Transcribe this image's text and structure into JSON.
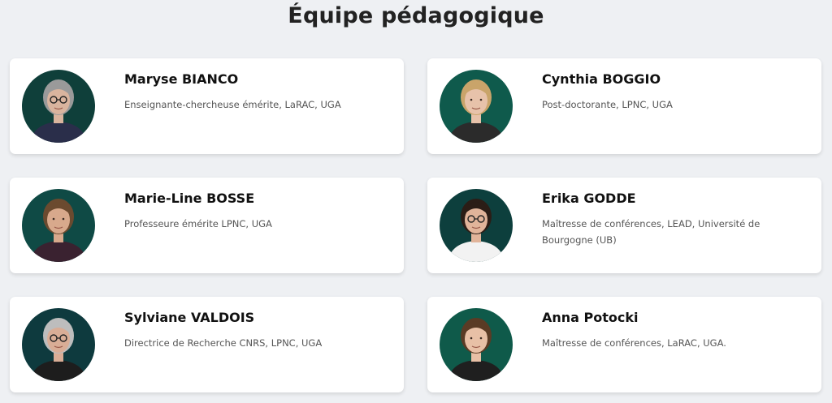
{
  "page": {
    "title": "Équipe pédagogique"
  },
  "members": [
    {
      "name": "Maryse BIANCO",
      "role": "Enseignante-chercheuse émérite, LaRAC, UGA",
      "photo": {
        "bg": "#0f3f3a",
        "hair": "#9a9a9a",
        "skin": "#d9b49e",
        "top": "#2a2e4a",
        "glasses": true
      }
    },
    {
      "name": "Cynthia BOGGIO",
      "role": "Post-doctorante, LPNC, UGA",
      "photo": {
        "bg": "#0f5a4c",
        "hair": "#c9a46a",
        "skin": "#e7c2aa",
        "top": "#2b2b2b",
        "glasses": false
      }
    },
    {
      "name": "Marie-Line BOSSE",
      "role": "Professeure émérite LPNC, UGA",
      "photo": {
        "bg": "#0f4a45",
        "hair": "#6b4a2f",
        "skin": "#d8a98c",
        "top": "#3a2230",
        "glasses": false
      }
    },
    {
      "name": "Erika GODDE",
      "role": "Maîtresse de conférences, LEAD, Université de Bourgogne (UB)",
      "photo": {
        "bg": "#0d3f3d",
        "hair": "#2b1d16",
        "skin": "#e1b49a",
        "top": "#f2f2f2",
        "glasses": true
      }
    },
    {
      "name": "Sylviane VALDOIS",
      "role": "Directrice de Recherche CNRS, LPNC, UGA",
      "photo": {
        "bg": "#0e3a3e",
        "hair": "#bdbdbd",
        "skin": "#d9ad96",
        "top": "#1d1d1d",
        "glasses": true
      }
    },
    {
      "name": "Anna Potocki",
      "role": "Maîtresse de conférences, LaRAC, UGA.",
      "photo": {
        "bg": "#0f5a4a",
        "hair": "#5a3b25",
        "skin": "#e8c0a6",
        "top": "#1f1f1f",
        "glasses": false
      }
    }
  ]
}
